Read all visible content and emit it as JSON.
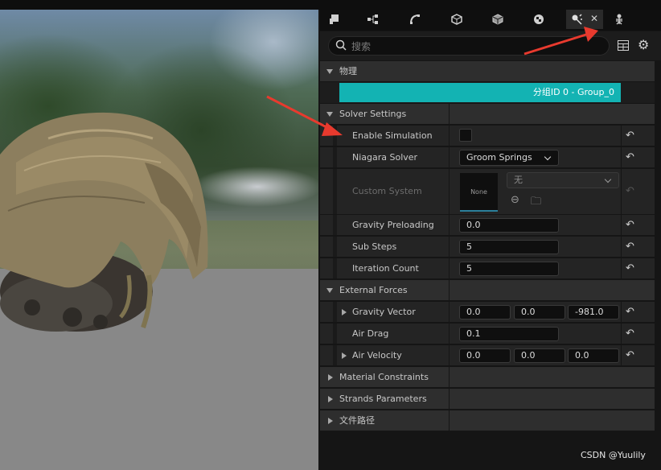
{
  "panel": {
    "tabs": [
      {
        "icon": "mesh-icon"
      },
      {
        "icon": "hierarchy-icon"
      },
      {
        "icon": "curve-icon"
      },
      {
        "icon": "cube-icon"
      },
      {
        "icon": "material-box-icon"
      },
      {
        "icon": "checker-ball-icon"
      },
      {
        "icon": "physics-icon",
        "active": true
      },
      {
        "icon": "skeleton-icon"
      }
    ],
    "search_placeholder": "搜索",
    "physics_header": "物理",
    "group_label": "分组ID 0 - Group_0",
    "solver_settings": {
      "title": "Solver Settings",
      "enable_simulation": "Enable Simulation",
      "niagara_solver": "Niagara Solver",
      "niagara_solver_value": "Groom Springs",
      "custom_system": "Custom System",
      "custom_system_thumb": "None",
      "custom_system_value": "无",
      "gravity_preloading": "Gravity Preloading",
      "gravity_preloading_value": "0.0",
      "sub_steps": "Sub Steps",
      "sub_steps_value": "5",
      "iteration_count": "Iteration Count",
      "iteration_count_value": "5"
    },
    "external_forces": {
      "title": "External Forces",
      "gravity_vector": "Gravity Vector",
      "gravity_x": "0.0",
      "gravity_y": "0.0",
      "gravity_z": "-981.0",
      "air_drag": "Air Drag",
      "air_drag_value": "0.1",
      "air_velocity": "Air Velocity",
      "air_x": "0.0",
      "air_y": "0.0",
      "air_z": "0.0"
    },
    "material_constraints": "Material Constraints",
    "strands_parameters": "Strands Parameters",
    "file_path": "文件路径"
  },
  "watermark": "CSDN @Yuulily",
  "colors": {
    "accent": "#13b3b3",
    "annotation_arrow": "#e83a2e"
  }
}
